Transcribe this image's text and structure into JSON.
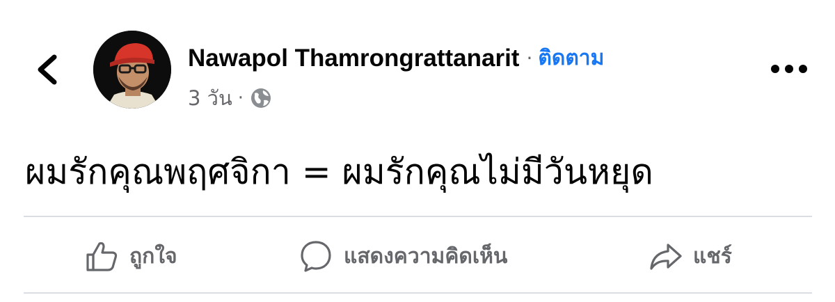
{
  "post": {
    "author": "Nawapol Thamrongrattanarit",
    "separator": "·",
    "follow_label": "ติดตาม",
    "time": "3 วัน",
    "meta_separator": "·",
    "privacy_icon": "globe-icon",
    "text": "ผมรักคุณพฤศจิกา = ผมรักคุณไม่มีวันหยุด"
  },
  "header": {
    "back_icon": "chevron-left-icon",
    "more_icon": "more-dots-icon"
  },
  "actions": [
    {
      "icon": "thumbs-up-icon",
      "label": "ถูกใจ"
    },
    {
      "icon": "comment-icon",
      "label": "แสดงความคิดเห็น"
    },
    {
      "icon": "share-icon",
      "label": "แชร์"
    }
  ],
  "colors": {
    "link": "#1877f2",
    "secondary_text": "#65676b",
    "primary_text": "#050505",
    "divider": "#dadde1"
  }
}
